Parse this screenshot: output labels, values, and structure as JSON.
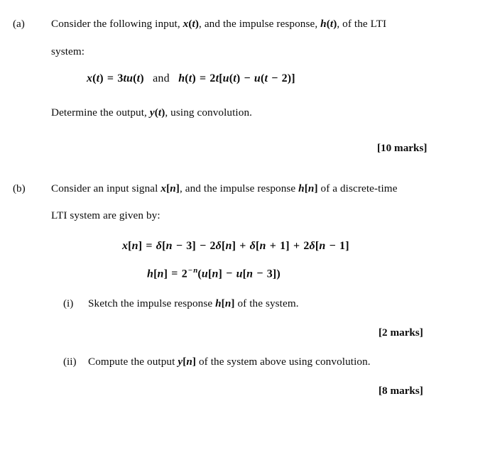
{
  "document": {
    "type": "exam-question",
    "background_color": "#ffffff",
    "text_color": "#0b0b0b"
  },
  "parts": {
    "a": {
      "label": "(a)",
      "line1": "Consider the following input, x(t), and the impulse response, h(t), of the LTI",
      "line2": "system:",
      "equation": "x(t) = 3tu(t)   and   h(t) = 2t[u(t) − u(t − 2)]",
      "line3": "Determine the output, y(t), using convolution.",
      "marks": "[10 marks]"
    },
    "b": {
      "label": "(b)",
      "line1": "Consider an input signal x[n], and the impulse response h[n] of a discrete-time",
      "line2": "LTI system are given by:",
      "equation1": "x[n] = δ[n − 3] − 2δ[n] + δ[n + 1] + 2δ[n − 1]",
      "equation2": "h[n] = 2⁻ⁿ(u[n] − u[n − 3])",
      "sub_items": [
        {
          "label": "(i)",
          "text": "Sketch the impulse response h[n] of the system.",
          "marks": "[2 marks]"
        },
        {
          "label": "(ii)",
          "text": "Compute the output y[n] of the system above using convolution.",
          "marks": "[8 marks]"
        }
      ]
    }
  }
}
